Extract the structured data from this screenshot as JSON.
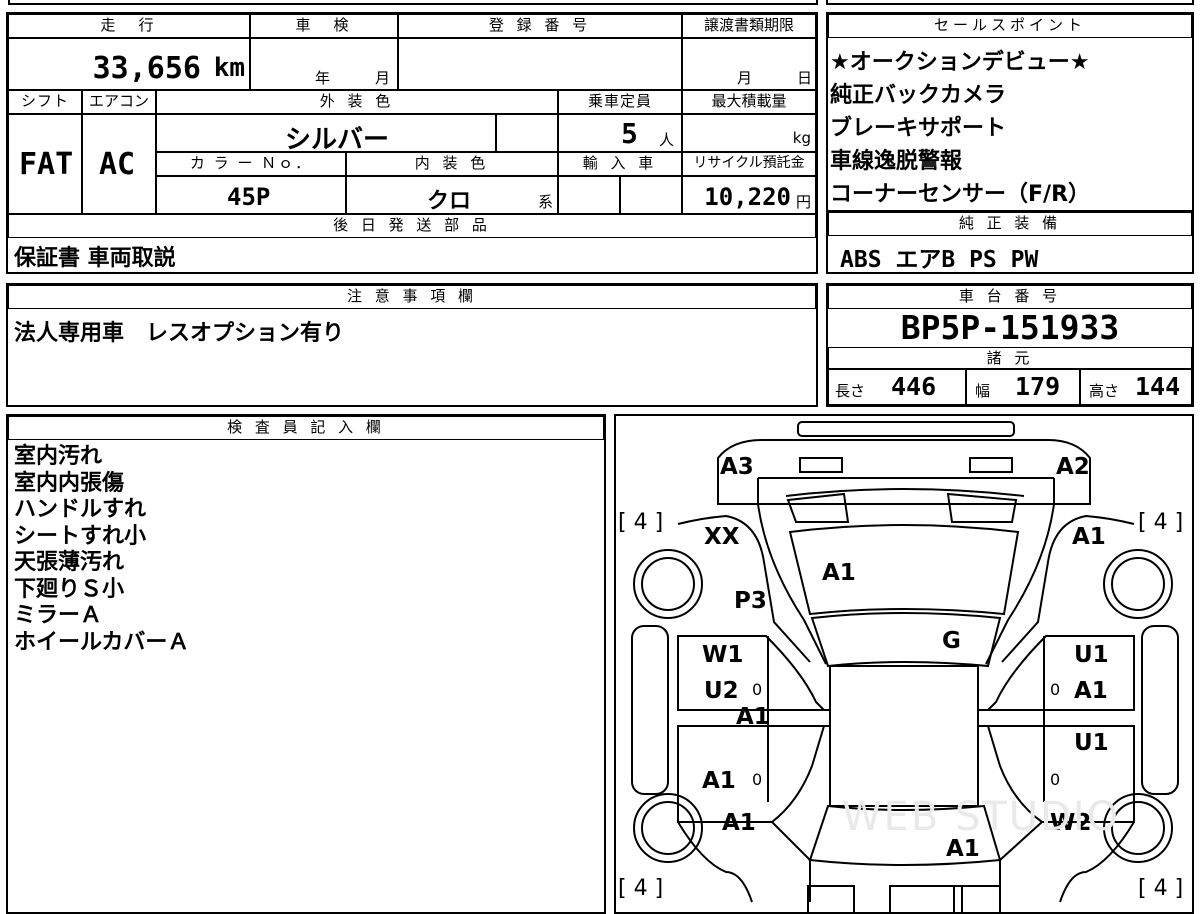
{
  "mileage": {
    "header": "走　行",
    "value": "33,656",
    "unit": "km"
  },
  "shaken": {
    "header": "車　検",
    "year_unit": "年",
    "month_unit": "月"
  },
  "registration": {
    "header": "登 録 番 号"
  },
  "transfer_deadline": {
    "header": "譲渡書類期限",
    "month_unit": "月",
    "day_unit": "日"
  },
  "sales_points": {
    "header": "セールスポイント",
    "items": [
      "★オークションデビュー★",
      "純正バックカメラ",
      "ブレーキサポート",
      "車線逸脱警報",
      "コーナーセンサー（F/R）"
    ]
  },
  "shift": {
    "header": "シフト",
    "value": "FAT"
  },
  "aircon": {
    "header": "エアコン",
    "value": "AC"
  },
  "exterior_color": {
    "header": "外 装 色",
    "value": "シルバー"
  },
  "capacity": {
    "header": "乗車定員",
    "value": "5",
    "unit": "人"
  },
  "max_load": {
    "header": "最大積載量",
    "unit": "kg"
  },
  "color_no": {
    "header": "カ ラ ー Ｎｏ．",
    "value": "45P"
  },
  "interior_color": {
    "header": "内 装 色",
    "value": "クロ",
    "suffix": "系"
  },
  "import": {
    "header": "輸 入 車"
  },
  "recycle": {
    "header": "リサイクル預託金",
    "value": "10,220",
    "unit": "円"
  },
  "later_parts": {
    "header": "後 日 発 送 部 品",
    "value": "保証書 車両取説"
  },
  "equipment": {
    "header": "純 正 装 備",
    "value": "ABS エアB PS PW"
  },
  "notes": {
    "header": "注 意 事 項 欄",
    "value": "法人専用車　レスオプション有り"
  },
  "chassis": {
    "header": "車 台 番 号",
    "value": "BP5P-151933"
  },
  "specs": {
    "header": "諸 元",
    "length_label": "長さ",
    "length": "446",
    "width_label": "幅",
    "width": "179",
    "height_label": "高さ",
    "height": "144"
  },
  "inspector": {
    "header": "検 査 員 記 入 欄",
    "lines": [
      "室内汚れ",
      "室内内張傷",
      "ハンドルすれ",
      "シートすれ小",
      "天張薄汚れ",
      "下廻りＳ小",
      "ミラーＡ",
      "ホイールカバーＡ"
    ]
  },
  "diagram": {
    "tire_marks": {
      "top_left": "[ 4 ]",
      "top_right": "[ 4 ]",
      "bottom_left": "[ 4 ]",
      "bottom_right": "[ 4 ]"
    },
    "labels": {
      "a3": "A3",
      "a2": "A2",
      "xx": "XX",
      "a1_front_right": "A1",
      "a1_hood": "A1",
      "p3": "P3",
      "g": "G",
      "w1": "W1",
      "u2": "U2",
      "a1_left_door": "A1",
      "u1_upper": "U1",
      "a1_right_door": "A1",
      "u1_lower": "U1",
      "a1_rear_left_door": "A1",
      "a1_rear_left": "A1",
      "w2": "W2",
      "a1_rear": "A1"
    },
    "zero_marks": [
      "0",
      "0",
      "0",
      "0",
      "0"
    ],
    "watermark": "WEB STUDIO"
  }
}
